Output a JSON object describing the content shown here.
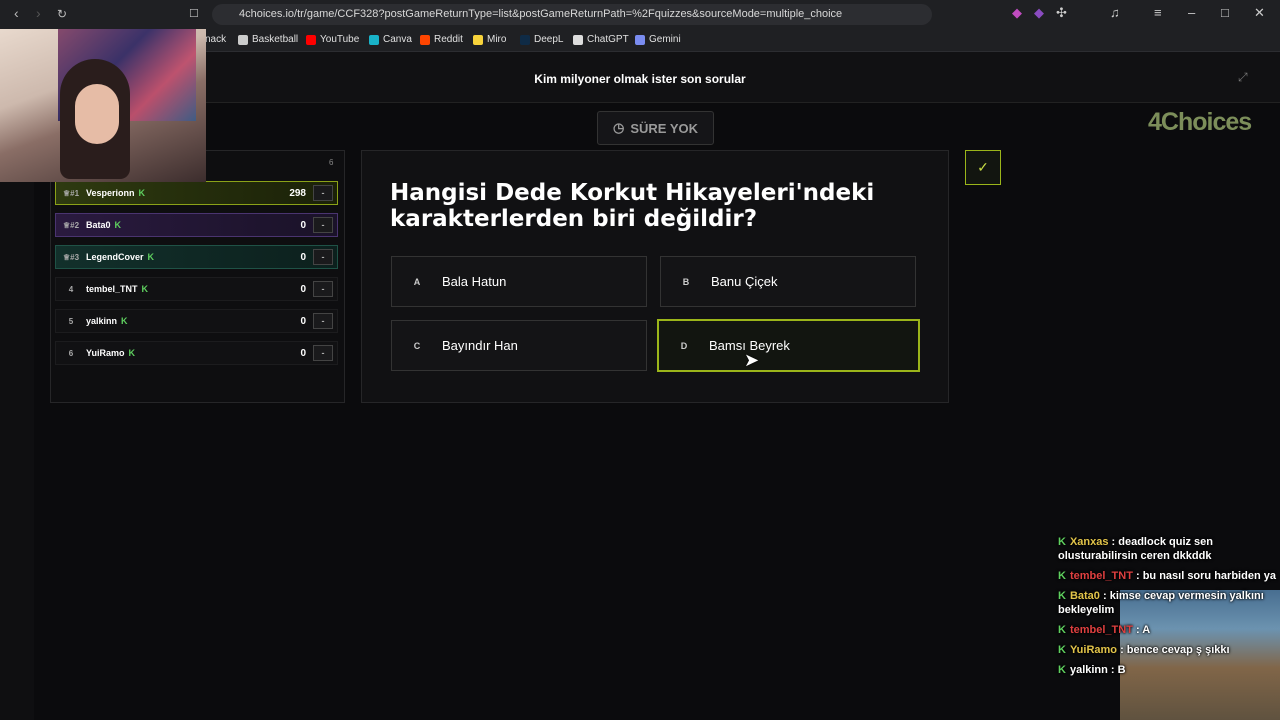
{
  "browser": {
    "url": "4choices.io/tr/game/CCF328?postGameReturnType=list&postGameReturnPath=%2Fquizzes&sourceMode=multiple_choice",
    "bookmarks": [
      {
        "label": "nack",
        "color": "#1f2023"
      },
      {
        "label": "Basketball",
        "color": "#cccccc"
      },
      {
        "label": "YouTube",
        "color": "#ff0000"
      },
      {
        "label": "Canva",
        "color": "#19b3c9"
      },
      {
        "label": "Reddit",
        "color": "#ff4500"
      },
      {
        "label": "Miro",
        "color": "#f7d33b"
      },
      {
        "label": "DeepL",
        "color": "#0f2b46"
      },
      {
        "label": "ChatGPT",
        "color": "#dddddd"
      },
      {
        "label": "Gemini",
        "color": "#7a8cf0"
      }
    ]
  },
  "page": {
    "title": "Kim milyoner olmak ister son sorular",
    "timer_label": "SÜRE YOK",
    "logo": "4Choices",
    "player_count": "6"
  },
  "leaderboard": [
    {
      "rank": "♕#1",
      "name": "Vesperionn",
      "score": "298",
      "tier": "r1"
    },
    {
      "rank": "♕#2",
      "name": "Bata0",
      "score": "0",
      "tier": "r2"
    },
    {
      "rank": "♕#3",
      "name": "LegendCover",
      "score": "0",
      "tier": "r3"
    },
    {
      "rank": "4",
      "name": "tembel_TNT",
      "score": "0",
      "tier": "plain"
    },
    {
      "rank": "5",
      "name": "yalkinn",
      "score": "0",
      "tier": "plain"
    },
    {
      "rank": "6",
      "name": "YuiRamo",
      "score": "0",
      "tier": "plain"
    }
  ],
  "leaderboard_k": "K",
  "leaderboard_dash": "-",
  "question": {
    "text": "Hangisi Dede Korkut Hikayeleri'ndeki karakterlerden biri değildir?",
    "answers": [
      {
        "letter": "A",
        "text": "Bala Hatun"
      },
      {
        "letter": "B",
        "text": "Banu Çiçek"
      },
      {
        "letter": "C",
        "text": "Bayındır Han"
      },
      {
        "letter": "D",
        "text": "Bamsı Beyrek"
      }
    ]
  },
  "chat": [
    {
      "user": "Xanxas",
      "msg": " : deadlock quiz sen olusturabilirsin ceren dkkddk",
      "color": "#e2c44a"
    },
    {
      "user": "tembel_TNT",
      "msg": " : bu nasıl soru harbiden ya",
      "color": "#e04040"
    },
    {
      "user": "Bata0",
      "msg": " : kimse cevap vermesin yalkını bekleyelim",
      "color": "#e2c44a"
    },
    {
      "user": "tembel_TNT",
      "msg": " : A",
      "color": "#e04040"
    },
    {
      "user": "YuiRamo",
      "msg": " : bence cevap ş şıkkı",
      "color": "#e2c44a"
    },
    {
      "user": "yalkinn",
      "msg": " : B",
      "color": "#ffffff"
    }
  ],
  "colors": {
    "accent": "#9bb51a",
    "background": "#0b0b0d"
  }
}
